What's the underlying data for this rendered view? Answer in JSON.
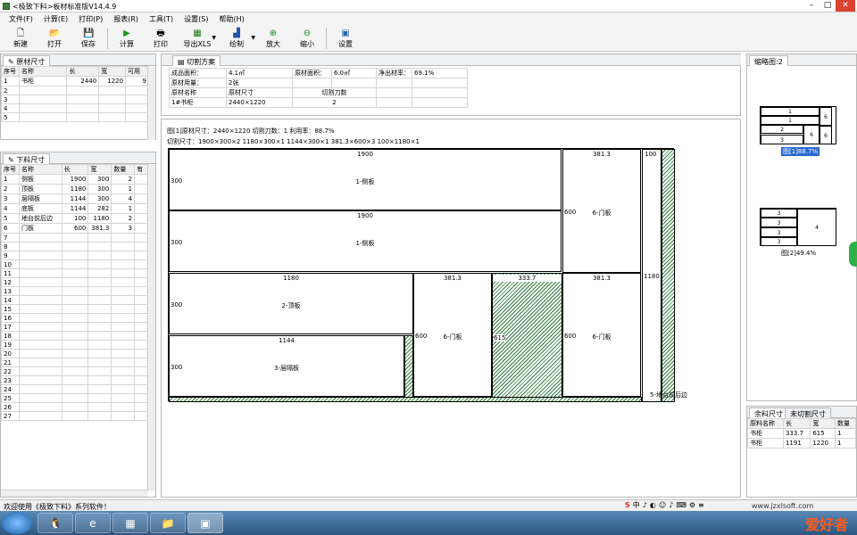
{
  "window": {
    "title": "<极致下料>板材标准版V14.4.9",
    "min": "–",
    "max": "□",
    "close": "✕"
  },
  "menu": [
    "文件(F)",
    "计算(E)",
    "打印(P)",
    "报表(R)",
    "工具(T)",
    "设置(S)",
    "帮助(H)"
  ],
  "toolbar": [
    "新建",
    "打开",
    "保存",
    "计算",
    "打印",
    "导出XLS",
    "绘制",
    "放大",
    "缩小",
    "设置"
  ],
  "raw_panel": {
    "tab": "原材尺寸",
    "headers": [
      "序号",
      "名称",
      "长",
      "宽",
      "可用"
    ],
    "rows": [
      [
        "1",
        "书柜",
        "2440",
        "1220",
        "9"
      ],
      [
        "2",
        "",
        "",
        "",
        ""
      ],
      [
        "3",
        "",
        "",
        "",
        ""
      ],
      [
        "4",
        "",
        "",
        "",
        ""
      ],
      [
        "5",
        "",
        "",
        "",
        ""
      ]
    ]
  },
  "cut_panel": {
    "tab": "下料尺寸",
    "headers": [
      "序号",
      "名称",
      "长",
      "宽",
      "数量",
      "有"
    ],
    "rows": [
      [
        "1",
        "侧板",
        "1900",
        "300",
        "2"
      ],
      [
        "2",
        "顶板",
        "1180",
        "300",
        "1"
      ],
      [
        "3",
        "层隔板",
        "1144",
        "300",
        "4"
      ],
      [
        "4",
        "底板",
        "1144",
        "282",
        "1"
      ],
      [
        "5",
        "地台前后边",
        "100",
        "1180",
        "2"
      ],
      [
        "6",
        "门板",
        "600",
        "381.3",
        "3"
      ]
    ],
    "empty_rows": [
      "7",
      "8",
      "9",
      "10",
      "11",
      "12",
      "13",
      "14",
      "15",
      "16",
      "17",
      "18",
      "19",
      "20",
      "21",
      "22",
      "23",
      "24",
      "25",
      "26",
      "27"
    ]
  },
  "plan_tab": "切割方案",
  "summary": {
    "r1": [
      "成品面积：",
      "4.1㎡",
      "原材面积：",
      "6.0㎡",
      "净出材率：",
      "69.1%"
    ],
    "r2": [
      "原材用量：",
      "2张"
    ],
    "r3": [
      "原材名称",
      "原材尺寸",
      "切割刀数"
    ],
    "r4": [
      "1#书柜",
      "2440×1220",
      "2"
    ]
  },
  "diagram": {
    "line1": "图[1]原材尺寸：2440×1220  切割刀数：1  利用率：88.7%",
    "line2": "切割尺寸：1900×300×2  1180×300×1  1144×300×1  381.3×600×3  100×1180×1",
    "pieces": [
      {
        "n": "1-侧板",
        "w": "1900",
        "h": "300"
      },
      {
        "n": "1-侧板",
        "w": "1900",
        "h": "300"
      },
      {
        "n": "2-顶板",
        "w": "1180",
        "h": "300"
      },
      {
        "n": "3-层隔板",
        "w": "1144",
        "h": "300"
      },
      {
        "n": "6-门板",
        "w": "381.3",
        "h": "600"
      },
      {
        "n": "6-门板",
        "w": "381.3",
        "h": "600"
      },
      {
        "n": "6-门板",
        "w": "381.3",
        "h": "600"
      },
      {
        "n": "5-地台前后边",
        "w": "100",
        "h": "1180"
      }
    ],
    "remnant": {
      "w": "333.7",
      "h": "615"
    }
  },
  "thumb_panel": {
    "tab": "缩略图:2",
    "t1": "图[1]88.7%",
    "t2": "图[2]49.4%",
    "t1cells": [
      "1",
      "1",
      "2",
      "3",
      "6",
      "6",
      "6"
    ],
    "t2cells": [
      "3",
      "3",
      "3",
      "3",
      "4"
    ]
  },
  "remain_panel": {
    "tabs": [
      "余料尺寸",
      "未切割尺寸"
    ],
    "headers": [
      "原料名称",
      "长",
      "宽",
      "数量"
    ],
    "rows": [
      [
        "书柜",
        "333.7",
        "615",
        "1"
      ],
      [
        "书柜",
        "1191",
        "1220",
        "1"
      ]
    ]
  },
  "status": "欢迎使用《极致下料》系列软件！",
  "tray": [
    "S",
    "中",
    "♪",
    "◐",
    "☺",
    "♪",
    "⌨",
    "⚙",
    "≡"
  ],
  "watermark": "www.jzxlsoft.com",
  "brand": "爱好者"
}
